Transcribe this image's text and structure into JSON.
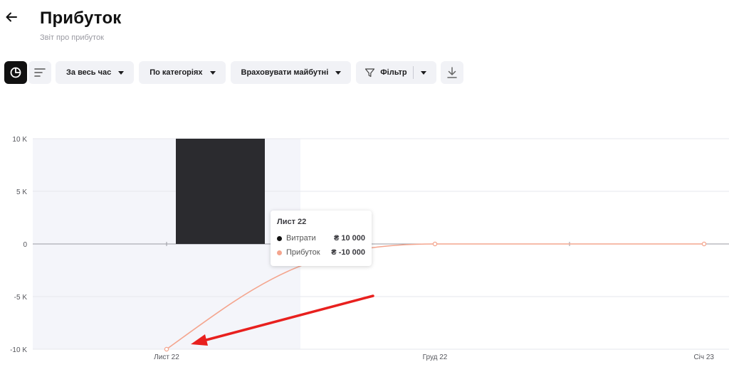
{
  "header": {
    "title": "Прибуток",
    "subtitle": "Звіт про прибуток"
  },
  "toolbar": {
    "period_label": "За весь час",
    "grouping_label": "По категоріях",
    "future_label": "Враховувати майбутні",
    "filter_label": "Фільтр"
  },
  "icons": {
    "back": "arrow-left-icon",
    "chart_view": "pie-chart-icon",
    "list_view": "list-lines-icon",
    "filter": "funnel-icon",
    "download": "download-icon"
  },
  "colors": {
    "expenses": "#2b2b2f",
    "profit": "#f4a58e",
    "highlight_band": "#f4f5fa",
    "annotation_arrow": "#e8201e"
  },
  "tooltip": {
    "title": "Лист 22",
    "rows": [
      {
        "name": "Витрати",
        "value": "₴ 10 000",
        "color": "#111111"
      },
      {
        "name": "Прибуток",
        "value": "₴ -10 000",
        "color": "#f4a58e"
      }
    ]
  },
  "chart_data": {
    "type": "bar",
    "categories": [
      "Лист 22",
      "Груд 22",
      "Січ 23"
    ],
    "y_tick_labels": [
      "10 K",
      "5 K",
      "0",
      "-5 K",
      "-10 K"
    ],
    "y_ticks": [
      10000,
      5000,
      0,
      -5000,
      -10000
    ],
    "ylim": [
      -10000,
      10000
    ],
    "grid": true,
    "highlighted_category": "Лист 22",
    "series": [
      {
        "name": "Витрати",
        "kind": "bar",
        "values": [
          10000,
          0,
          0
        ]
      },
      {
        "name": "Прибуток",
        "kind": "line",
        "values": [
          -10000,
          0,
          0
        ]
      }
    ]
  }
}
